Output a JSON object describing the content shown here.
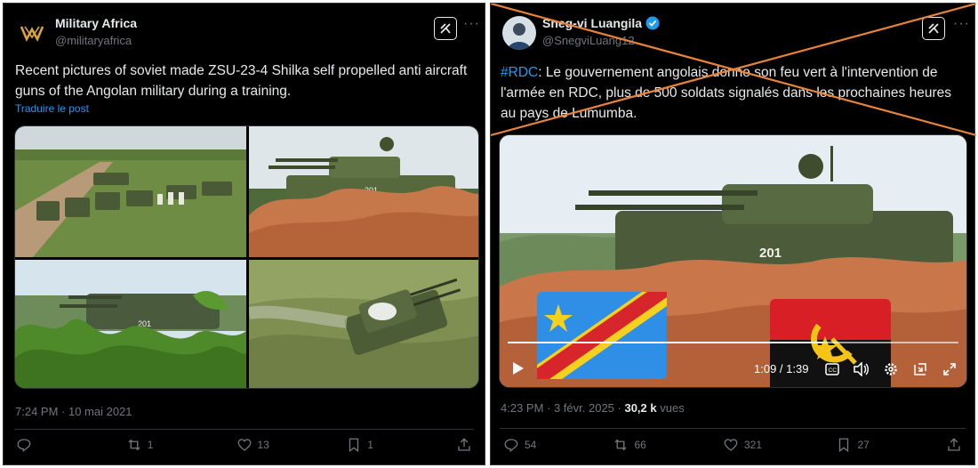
{
  "left_post": {
    "author_name": "Military Africa",
    "handle": "@militaryafrica",
    "text": "Recent pictures of soviet made ZSU-23-4 Shilka self propelled anti aircraft guns of the Angolan military during a training.",
    "translate_label": "Traduire le post",
    "timestamp": "7:24 PM · 10 mai 2021",
    "actions": {
      "replies": "",
      "reposts": "1",
      "likes": "13",
      "bookmarks": "1"
    },
    "icons": [
      "grok-icon",
      "more-icon",
      "reply-icon",
      "repost-icon",
      "like-icon",
      "bookmark-icon",
      "share-icon"
    ]
  },
  "right_post": {
    "author_name": "Sneg-vi Luangila",
    "handle": "@SnegviLuang12",
    "hashtag": "#RDC",
    "text": ": Le gouvernement angolais donne son feu vert à l'intervention de l'armée en RDC, plus de 500 soldats signalés dans les prochaines heures au pays de Lumumba.",
    "timestamp": "4:23 PM · 3 févr. 2025 · ",
    "views_count": "30,2 k",
    "views_label": " vues",
    "video": {
      "time": "1:09 / 1:39",
      "hull_number": "201",
      "progress": 0.7
    },
    "actions": {
      "replies": "54",
      "reposts": "66",
      "likes": "321",
      "bookmarks": "27"
    },
    "icons": [
      "verified-badge-icon",
      "grok-icon",
      "more-icon",
      "play-icon",
      "captions-icon",
      "volume-icon",
      "settings-icon",
      "pip-icon",
      "fullscreen-icon"
    ]
  },
  "photos": {
    "hull_number": "201"
  },
  "colors": {
    "background": "#000000",
    "text": "#e7e9ea",
    "muted": "#71767b",
    "link": "#1d9bf0",
    "cross": "#e8843a",
    "verified": "#1d9bf0"
  }
}
